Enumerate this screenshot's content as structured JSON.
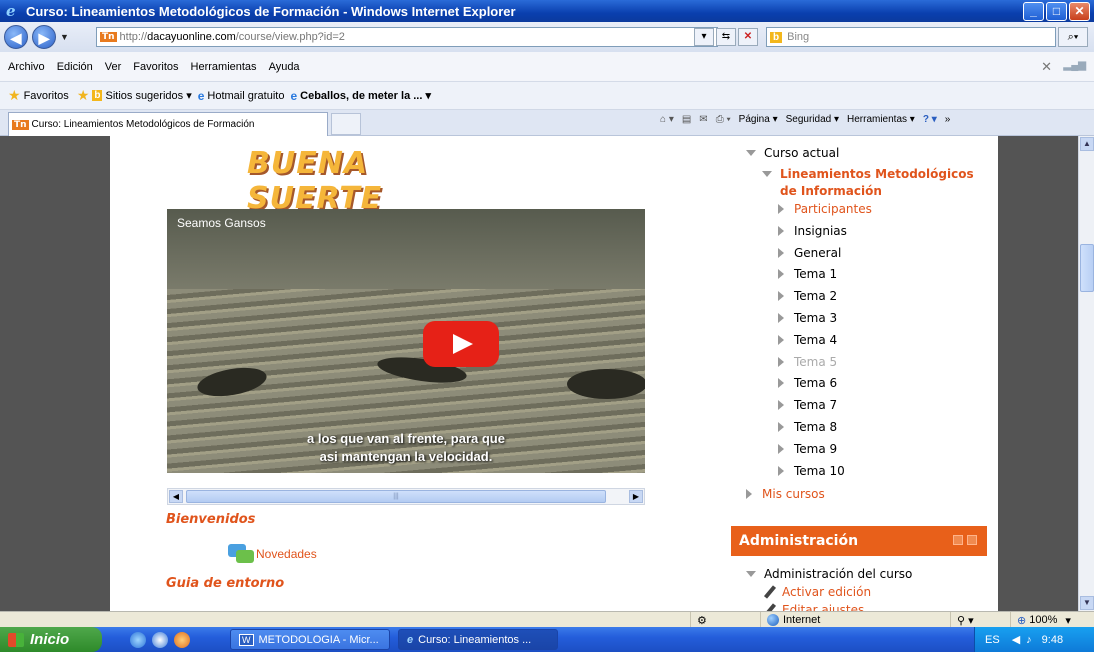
{
  "window": {
    "title": "Curso: Lineamientos Metodológicos de Formación - Windows Internet Explorer",
    "controls": [
      "_",
      "□",
      "✕"
    ]
  },
  "address": {
    "prefix": "http://",
    "host": "dacayuonline.com",
    "path": "/course/view.php?id=2",
    "favicon": "Tn",
    "search_placeholder": "Bing",
    "bing_logo": "b"
  },
  "menu": [
    "Archivo",
    "Edición",
    "Ver",
    "Favoritos",
    "Herramientas",
    "Ayuda"
  ],
  "favorites": {
    "label": "Favoritos",
    "items": [
      {
        "label": "Sitios sugeridos ▾",
        "icon": "b"
      },
      {
        "label": "Hotmail gratuito",
        "icon": "e"
      },
      {
        "label": "Ceballos, de meter la ... ▾",
        "icon": "e",
        "bold": true
      }
    ]
  },
  "tab": {
    "label": "Curso: Lineamientos Metodológicos de Formación"
  },
  "commandbar": [
    "Página ▾",
    "Seguridad ▾",
    "Herramientas ▾"
  ],
  "main": {
    "banner": "BUENA SUERTE",
    "video": {
      "title": "Seamos Gansos",
      "subtitle_line1": "a los que van al frente, para que",
      "subtitle_line2": "asi mantengan la velocidad."
    },
    "section_welcome": "Bienvenidos",
    "news_link": "Novedades",
    "section_guide": "Guia de entorno"
  },
  "sidebar": {
    "current_course": "Curso actual",
    "course_name_line1": "Lineamientos Metodológicos",
    "course_name_line2": "de Información",
    "items": [
      {
        "label": "Participantes",
        "style": "orange"
      },
      {
        "label": "Insignias",
        "style": "normal"
      },
      {
        "label": "General",
        "style": "normal"
      },
      {
        "label": "Tema 1",
        "style": "normal"
      },
      {
        "label": "Tema 2",
        "style": "normal"
      },
      {
        "label": "Tema 3",
        "style": "normal"
      },
      {
        "label": "Tema 4",
        "style": "normal"
      },
      {
        "label": "Tema 5",
        "style": "grey"
      },
      {
        "label": "Tema 6",
        "style": "normal"
      },
      {
        "label": "Tema 7",
        "style": "normal"
      },
      {
        "label": "Tema 8",
        "style": "normal"
      },
      {
        "label": "Tema 9",
        "style": "normal"
      },
      {
        "label": "Tema 10",
        "style": "normal"
      }
    ],
    "my_courses": "Mis cursos",
    "admin_title": "Administración",
    "admin_course": "Administración del curso",
    "activate_edit": "Activar edición",
    "edit_settings": "Editar ajustes"
  },
  "statusbar": {
    "zone": "Internet",
    "zoom": "100%"
  },
  "taskbar": {
    "start": "Inicio",
    "tasks": [
      "METODOLOGIA - Micr...",
      "Curso: Lineamientos ..."
    ],
    "lang": "ES",
    "time": "9:48"
  }
}
